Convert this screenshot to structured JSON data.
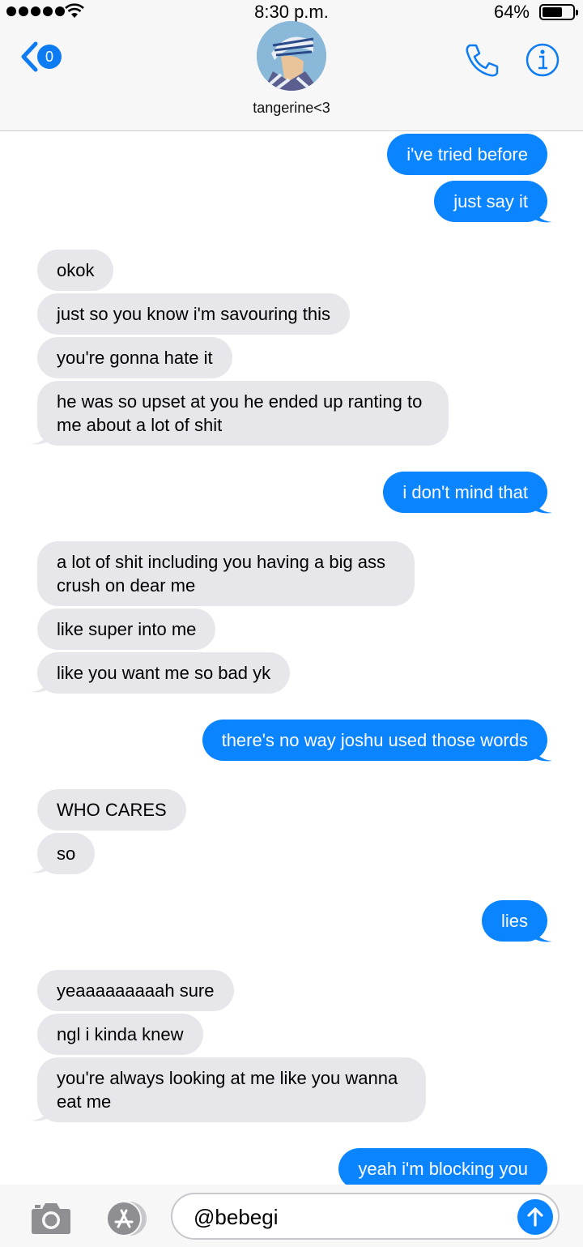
{
  "status_bar": {
    "time": "8:30 p.m.",
    "battery_percent": "64%"
  },
  "header": {
    "back_count": "0",
    "contact_name": "tangerine<3"
  },
  "messages": [
    {
      "from": "me",
      "text": "i've tried before"
    },
    {
      "from": "me",
      "text": "just say it"
    },
    {
      "from": "them",
      "text": "okok"
    },
    {
      "from": "them",
      "text": "just so you know i'm savouring this"
    },
    {
      "from": "them",
      "text": "you're gonna hate it"
    },
    {
      "from": "them",
      "text": "he was so upset at you he ended up ranting to me about a lot of shit"
    },
    {
      "from": "me",
      "text": "i don't mind that"
    },
    {
      "from": "them",
      "text": "a lot of shit including you having a big ass crush on dear me"
    },
    {
      "from": "them",
      "text": "like super into me"
    },
    {
      "from": "them",
      "text": "like you want me so bad yk"
    },
    {
      "from": "me",
      "text": "there's no way joshu used those words"
    },
    {
      "from": "them",
      "text": "WHO CARES"
    },
    {
      "from": "them",
      "text": "so"
    },
    {
      "from": "me",
      "text": "lies"
    },
    {
      "from": "them",
      "text": "yeaaaaaaaaah sure"
    },
    {
      "from": "them",
      "text": "ngl i kinda knew"
    },
    {
      "from": "them",
      "text": "you're always looking at me like you wanna eat me"
    },
    {
      "from": "me",
      "text": "yeah i'm blocking you"
    }
  ],
  "input": {
    "value": "@bebegi"
  },
  "colors": {
    "sent_bubble": "#0a84ff",
    "received_bubble": "#e6e6eb",
    "accent": "#0d7cf2"
  }
}
